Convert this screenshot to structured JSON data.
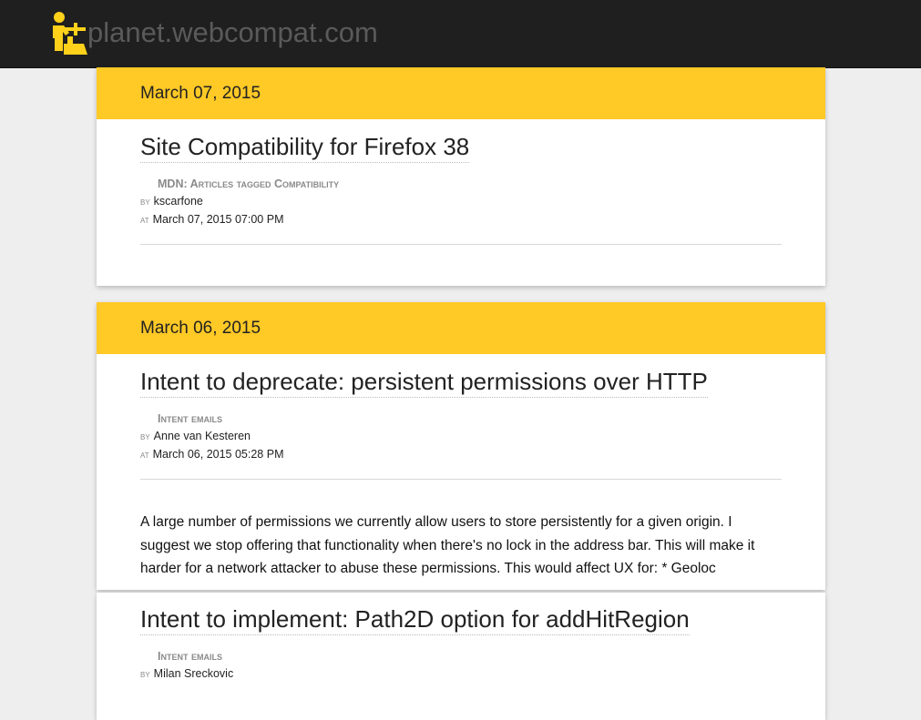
{
  "site": {
    "title": "planet.webcompat.com"
  },
  "days": [
    {
      "date": "March 07, 2015",
      "entries": [
        {
          "title": "Site Compatibility for Firefox 38",
          "source": "MDN: Articles tagged Compatibility",
          "by_label": "by",
          "author": "kscarfone",
          "at_label": "at",
          "time": "March 07, 2015 07:00 PM"
        }
      ]
    },
    {
      "date": "March 06, 2015",
      "entries": [
        {
          "title": "Intent to deprecate: persistent permissions over HTTP",
          "source": "Intent emails",
          "by_label": "by",
          "author": "Anne van Kesteren",
          "at_label": "at",
          "time": "March 06, 2015 05:28 PM",
          "excerpt": "A large number of permissions we currently allow users to store persistently for a given origin. I suggest we stop offering that functionality when there's no lock in the address bar. This will make it harder for a network attacker to abuse these permissions. This would affect UX for: * Geoloc"
        },
        {
          "title": "Intent to implement: Path2D option for addHitRegion",
          "source": "Intent emails",
          "by_label": "by",
          "author": "Milan Sreckovic"
        }
      ]
    }
  ],
  "colors": {
    "topbar": "#1f1f1f",
    "accent": "#ffc926",
    "logo": "#ffd11a"
  },
  "icons": {
    "logo": "webcompat-fixer-icon"
  }
}
